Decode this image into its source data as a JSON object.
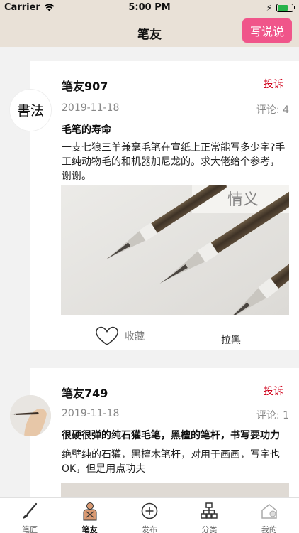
{
  "status_bar": {
    "carrier": "Carrier",
    "time": "5:00 PM"
  },
  "nav": {
    "title": "笔友",
    "write_button": "写说说"
  },
  "posts": [
    {
      "username": "笔友907",
      "report": "投诉",
      "date": "2019-11-18",
      "comments": "评论: 4",
      "title": "毛笔的寿命",
      "body": "一支七狼三羊兼毫毛笔在宣纸上正常能写多少字?手工纯动物毛的和机器加尼龙的。求大佬给个参考，谢谢。",
      "favorite_label": "收藏",
      "block_label": "拉黑",
      "avatar_text": "書法",
      "image_text": "情义"
    },
    {
      "username": "笔友749",
      "report": "投诉",
      "date": "2019-11-18",
      "comments": "评论: 1",
      "title": "很硬很弹的纯石獾毛笔，黑檀的笔杆，书写要功力",
      "body": "绝壁纯的石獾，黑檀木笔杆，对用于画画，写字也OK，但是用点功夫"
    }
  ],
  "tabs": [
    {
      "label": "笔匠",
      "icon": "brush-icon",
      "active": false
    },
    {
      "label": "笔友",
      "icon": "friends-icon",
      "active": true
    },
    {
      "label": "发布",
      "icon": "plus-circle-icon",
      "active": false
    },
    {
      "label": "分类",
      "icon": "category-icon",
      "active": false
    },
    {
      "label": "我的",
      "icon": "home-icon",
      "active": false
    }
  ],
  "colors": {
    "header_bg": "#e9e1d7",
    "accent_pink": "#f0558a",
    "report_red": "#d0021b"
  }
}
